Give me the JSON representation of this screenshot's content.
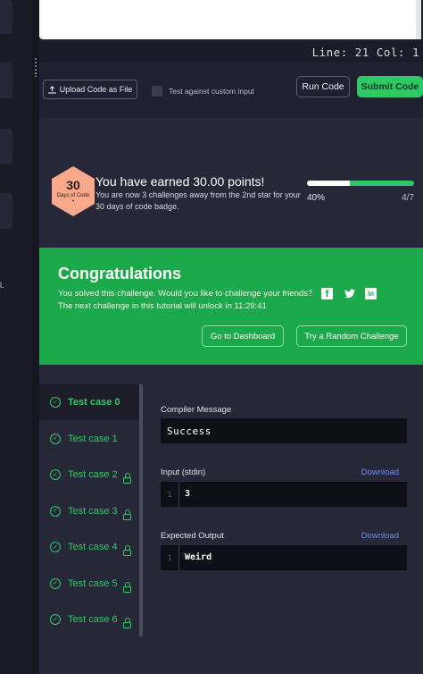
{
  "status": {
    "line_col": "Line: 21 Col: 1"
  },
  "toolbar": {
    "upload_label": "Upload Code as File",
    "upload_icon": "upload-icon",
    "custom_input_label": "Test against custom input",
    "run_label": "Run Code",
    "submit_label": "Submit Code"
  },
  "left_rail": {
    "mark": "l."
  },
  "badge": {
    "number": "30",
    "label": "Days of Code",
    "dot": "•"
  },
  "points": {
    "title": "You have earned 30.00 points!",
    "subtitle": "You are now 3 challenges away from the 2nd star for your 30 days of code badge.",
    "progress_percent": "40%",
    "progress_value": 0.4,
    "progress_count": "4/7"
  },
  "congrats": {
    "title": "Congratulations",
    "line1": "You solved this challenge. Would you like to challenge your friends?",
    "line2": "The next challenge in this tutorial will unlock in 11:29:41",
    "social": {
      "facebook": "f",
      "twitter": "🐦",
      "linkedin": "in"
    },
    "dashboard_label": "Go to Dashboard",
    "random_label": "Try a Random Challenge"
  },
  "test_cases": [
    {
      "label": "Test case 0",
      "locked": false,
      "active": true
    },
    {
      "label": "Test case 1",
      "locked": false,
      "active": false
    },
    {
      "label": "Test case 2",
      "locked": true,
      "active": false
    },
    {
      "label": "Test case 3",
      "locked": true,
      "active": false
    },
    {
      "label": "Test case 4",
      "locked": true,
      "active": false
    },
    {
      "label": "Test case 5",
      "locked": true,
      "active": false
    },
    {
      "label": "Test case 6",
      "locked": true,
      "active": false
    }
  ],
  "output": {
    "compiler_label": "Compiler Message",
    "compiler_value": "Success",
    "input_label": "Input (stdin)",
    "input_line_no": "1",
    "input_value": "3",
    "expected_label": "Expected Output",
    "expected_line_no": "1",
    "expected_value": "Weird",
    "download_label": "Download"
  },
  "colors": {
    "accent_green": "#2ec866",
    "banner_green": "#1ba94c",
    "link_blue": "#6e8cf0",
    "badge_orange": "#f8a98b"
  }
}
